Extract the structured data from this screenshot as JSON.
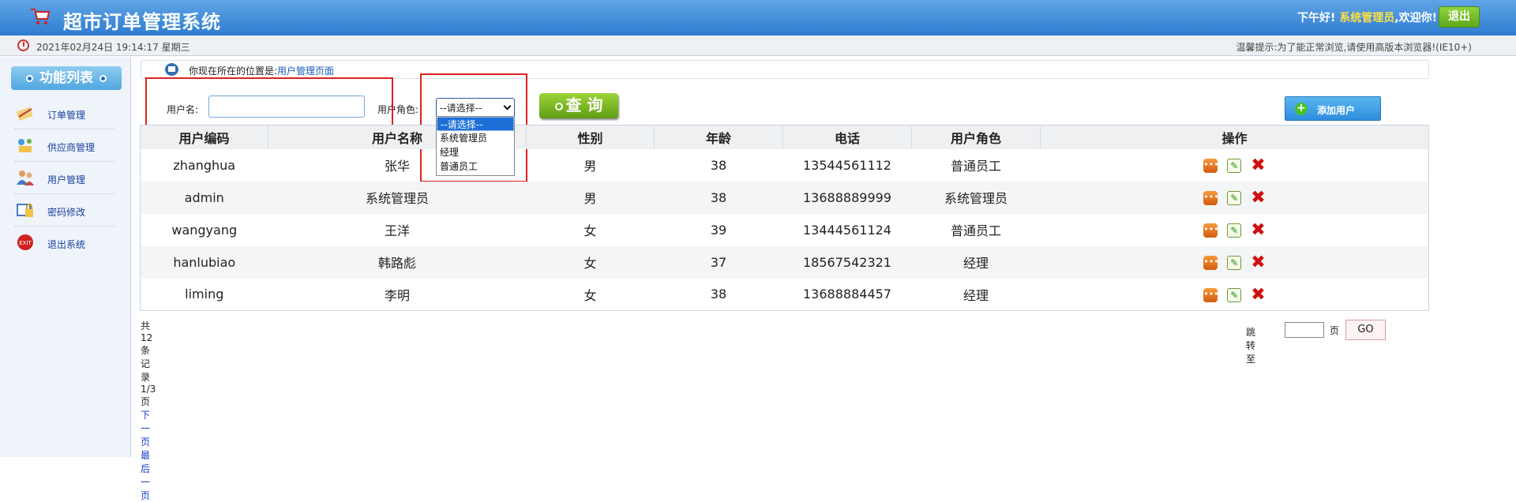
{
  "header": {
    "app_title": "超市订单管理系统",
    "greeting_prefix": "下午好!",
    "user_role": "系统管理员",
    "greeting_suffix": ",欢迎你!",
    "logout_label": "退出"
  },
  "infobar": {
    "datetime": "2021年02月24日 19:14:17 星期三",
    "tip": "温馨提示:为了能正常浏览,请使用高版本浏览器!(IE10+)"
  },
  "sidebar": {
    "title": "功能列表",
    "items": [
      {
        "label": "订单管理",
        "icon": "order-icon"
      },
      {
        "label": "供应商管理",
        "icon": "provider-icon"
      },
      {
        "label": "用户管理",
        "icon": "users-icon"
      },
      {
        "label": "密码修改",
        "icon": "password-icon"
      },
      {
        "label": "退出系统",
        "icon": "exit-icon"
      }
    ]
  },
  "location": {
    "prefix": "你现在所在的位置是:",
    "page": "用户管理页面"
  },
  "search": {
    "username_label": "用户名:",
    "username_value": "",
    "role_label": "用户角色:",
    "role_selected": "--请选择--",
    "role_options": [
      "--请选择--",
      "系统管理员",
      "经理",
      "普通员工"
    ],
    "query_label": "查 询",
    "add_label": "添加用户"
  },
  "table": {
    "headers": [
      "用户编码",
      "用户名称",
      "性别",
      "年龄",
      "电话",
      "用户角色",
      "操作"
    ],
    "rows": [
      [
        "zhanghua",
        "张华",
        "男",
        "38",
        "13544561112",
        "普通员工"
      ],
      [
        "admin",
        "系统管理员",
        "男",
        "38",
        "13688889999",
        "系统管理员"
      ],
      [
        "wangyang",
        "王洋",
        "女",
        "39",
        "13444561124",
        "普通员工"
      ],
      [
        "hanlubiao",
        "韩路彪",
        "女",
        "37",
        "18567542321",
        "经理"
      ],
      [
        "liming",
        "李明",
        "女",
        "38",
        "13688884457",
        "经理"
      ]
    ]
  },
  "pager": {
    "total": "共12条记录",
    "page": "1/3页",
    "next": "下一页",
    "last": "最后一页",
    "jump_label": "跳转至",
    "jump_value": "",
    "page_unit": "页",
    "go_label": "GO"
  }
}
